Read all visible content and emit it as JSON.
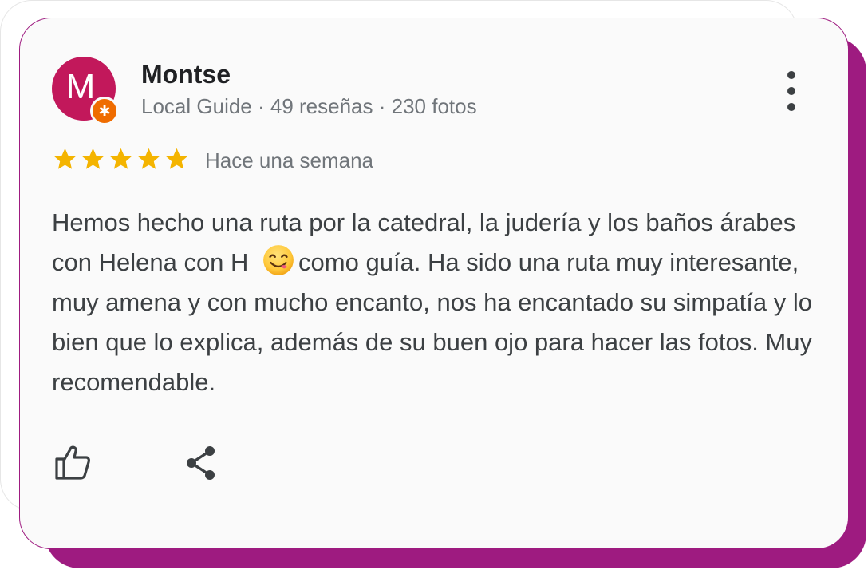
{
  "review": {
    "author": {
      "avatar_letter": "M",
      "name": "Montse",
      "meta": "Local Guide · 49 reseñas · 230 fotos",
      "badge_icon": "star-badge-icon"
    },
    "rating": {
      "value": 5,
      "max": 5,
      "star_color": "#f4b400"
    },
    "date": "Hace una semana",
    "text_before_emoji": "Hemos hecho una ruta por la catedral, la judería y los baños árabes con Helena con H",
    "emoji_name": "yum-face-emoji",
    "text_after_emoji": "como guía. Ha sido una ruta muy interesante, muy amena y con mucho encanto, nos ha encantado su simpatía y lo bien que lo explica, además de su buen ojo para hacer las fotos. Muy recomendable."
  },
  "actions": {
    "like_icon": "thumbs-up-icon",
    "share_icon": "share-icon",
    "more_icon": "more-vert-icon"
  },
  "colors": {
    "accent": "#9e1b80",
    "avatar_bg": "#c2185b",
    "badge_bg": "#ef6c00",
    "text_primary": "#202124",
    "text_secondary": "#70757a"
  }
}
